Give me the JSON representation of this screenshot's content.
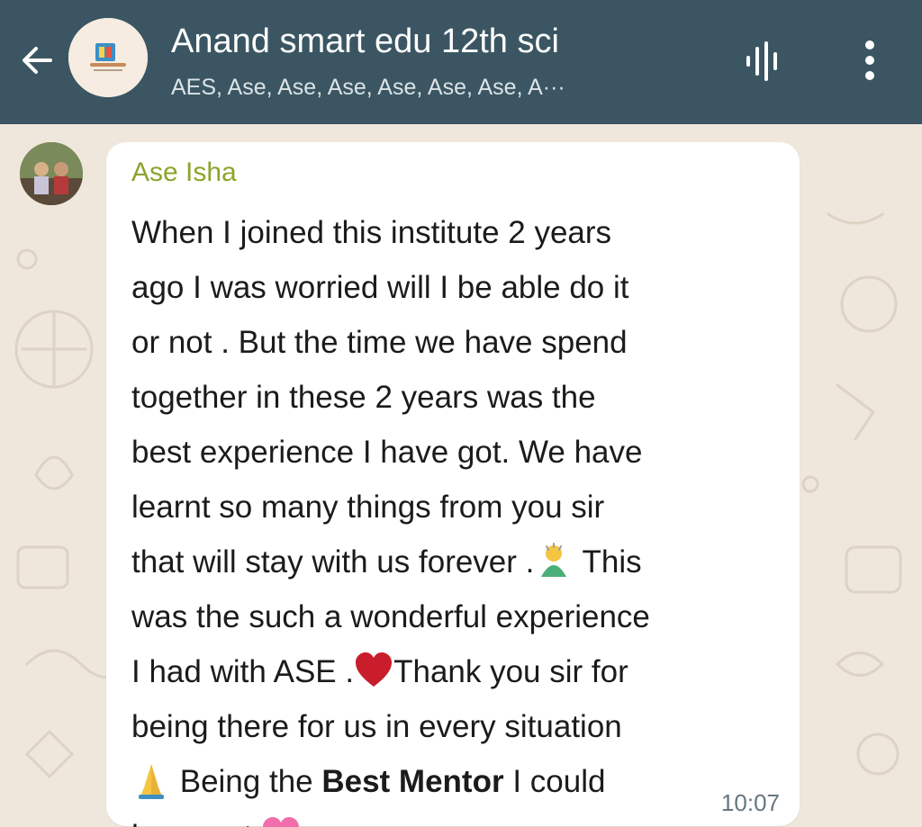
{
  "header": {
    "title": "Anand smart edu 12th sci",
    "subtitle": "AES, Ase, Ase, Ase, Ase, Ase, Ase, A···",
    "icons": [
      "back-arrow-icon",
      "group-avatar",
      "audio-wave-icon",
      "more-vert-icon"
    ]
  },
  "message": {
    "sender": "Ase Isha",
    "time": "10:07",
    "lines": {
      "l1": "When I joined this institute 2 years",
      "l2": "ago I was worried will I be able do it",
      "l3": "or not . But the time we have spend",
      "l4": "together in these 2 years was the",
      "l5": "best experience I have got. We have",
      "l6": "learnt so many things from you sir",
      "l7a": "that will stay with us forever .",
      "l7b": " This",
      "l8": "was the such a wonderful experience",
      "l9a": "I had with ASE .",
      "l9b": "Thank you sir for",
      "l10": "being there for us in every situation",
      "l11a": " Being the ",
      "l11b": "Best Mentor",
      "l11c": " I could",
      "l12": "have got"
    },
    "emoji_icons": [
      "bowing-person-icon",
      "red-heart-icon",
      "folded-hands-icon",
      "sparkling-heart-icon"
    ]
  },
  "colors": {
    "header_bg": "#3b5662",
    "chat_bg": "#efe7dc",
    "bubble_bg": "#ffffff",
    "sender_name": "#8aa52c",
    "timestamp": "#667781"
  }
}
